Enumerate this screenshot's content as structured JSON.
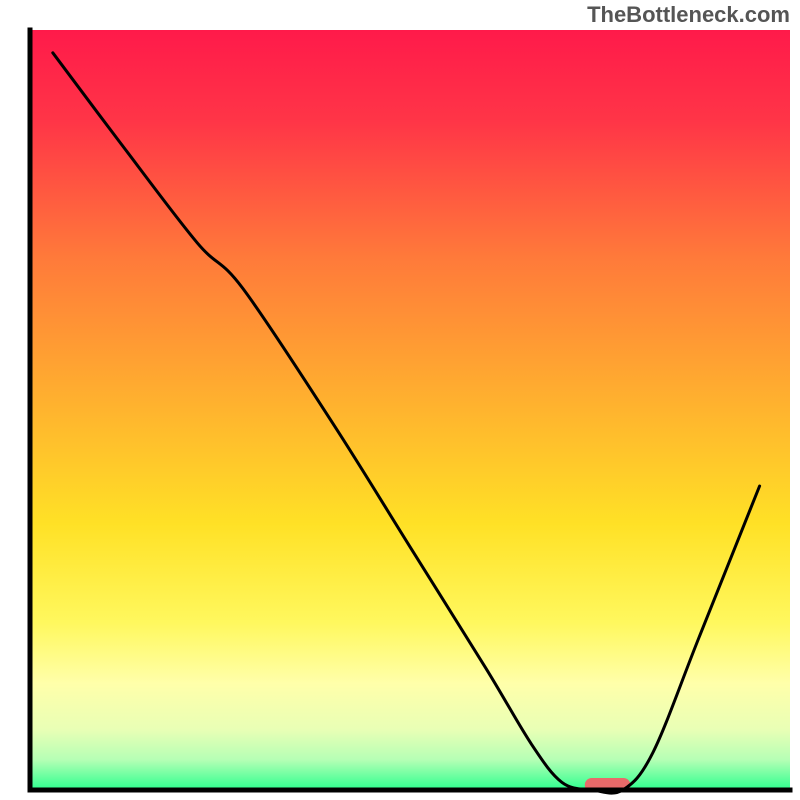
{
  "watermark": "TheBottleneck.com",
  "chart_data": {
    "type": "line",
    "title": "",
    "xlabel": "",
    "ylabel": "",
    "xlim": [
      0,
      100
    ],
    "ylim": [
      0,
      100
    ],
    "background_gradient": {
      "stops": [
        {
          "offset": 0.0,
          "color": "#ff1a4a"
        },
        {
          "offset": 0.12,
          "color": "#ff3547"
        },
        {
          "offset": 0.3,
          "color": "#ff7a3a"
        },
        {
          "offset": 0.5,
          "color": "#ffb42e"
        },
        {
          "offset": 0.65,
          "color": "#ffe126"
        },
        {
          "offset": 0.78,
          "color": "#fff85e"
        },
        {
          "offset": 0.86,
          "color": "#ffffaa"
        },
        {
          "offset": 0.92,
          "color": "#e9ffb5"
        },
        {
          "offset": 0.96,
          "color": "#b6ffb5"
        },
        {
          "offset": 1.0,
          "color": "#2dff8f"
        }
      ]
    },
    "series": [
      {
        "name": "bottleneck-curve",
        "x": [
          3,
          12,
          22,
          28,
          40,
          50,
          60,
          66,
          70,
          74,
          78,
          82,
          88,
          96
        ],
        "y": [
          97,
          85,
          72,
          66,
          48,
          32,
          16,
          6,
          1,
          0,
          0,
          5,
          20,
          40
        ]
      }
    ],
    "marker": {
      "name": "optimal-marker",
      "x": 76,
      "y": 0,
      "width": 6,
      "color": "#e86a6a"
    },
    "frame_color": "#000000",
    "line_color": "#000000"
  }
}
